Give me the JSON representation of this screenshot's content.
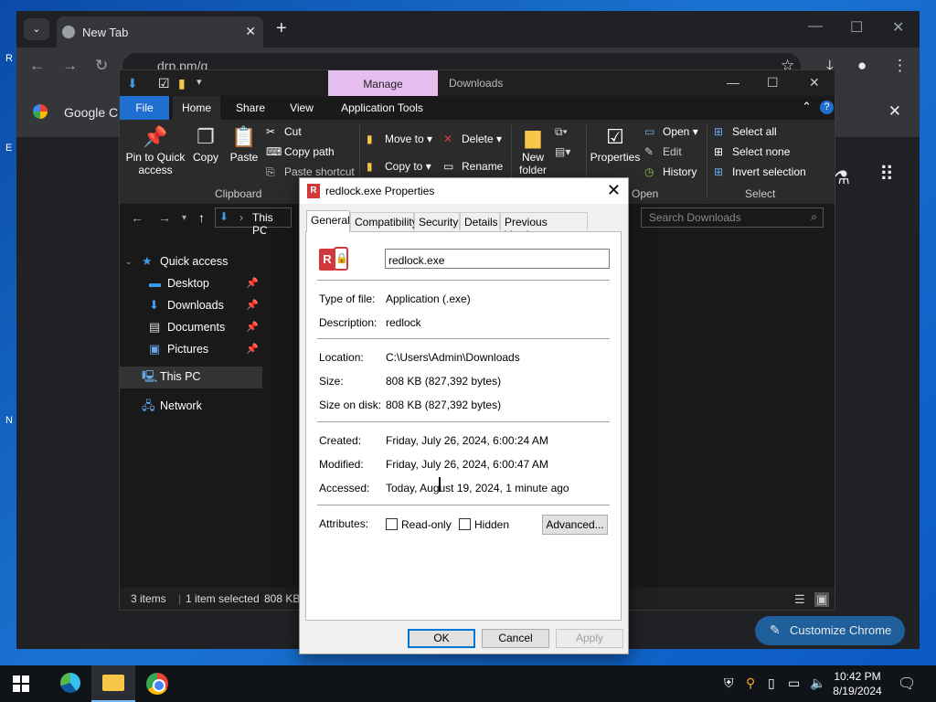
{
  "desktop": {
    "edge_letters": [
      "R",
      "E",
      "N"
    ]
  },
  "chrome": {
    "tab_title": "New Tab",
    "omnibox_text": "drp.pm/g",
    "google_bar_text": "Google Ch",
    "customize_label": "Customize Chrome"
  },
  "explorer": {
    "manage_label": "Manage",
    "window_title": "Downloads",
    "ribbon_tabs": [
      "File",
      "Home",
      "Share",
      "View",
      "Application Tools"
    ],
    "ribbon": {
      "pin_label": "Pin to Quick access",
      "copy_label": "Copy",
      "paste_label": "Paste",
      "cut_label": "Cut",
      "copy_path_label": "Copy path",
      "paste_shortcut_label": "Paste shortcut",
      "clipboard_group": "Clipboard",
      "move_to_label": "Move to",
      "copy_to_label": "Copy to",
      "delete_label": "Delete",
      "rename_label": "Rename",
      "new_folder_label": "New folder",
      "properties_label": "Properties",
      "open_label": "Open",
      "edit_label": "Edit",
      "history_label": "History",
      "open_group": "Open",
      "select_all_label": "Select all",
      "select_none_label": "Select none",
      "invert_selection_label": "Invert selection",
      "select_group": "Select"
    },
    "address_text": "This PC",
    "search_placeholder": "Search Downloads",
    "nav": {
      "quick_access": "Quick access",
      "desktop": "Desktop",
      "downloads": "Downloads",
      "documents": "Documents",
      "pictures": "Pictures",
      "this_pc": "This PC",
      "network": "Network"
    },
    "status": {
      "items": "3 items",
      "selected": "1 item selected",
      "size": "808 KB"
    }
  },
  "dialog": {
    "title": "redlock.exe Properties",
    "tabs": [
      "General",
      "Compatibility",
      "Security",
      "Details",
      "Previous Versions"
    ],
    "file_name": "redlock.exe",
    "type_label": "Type of file:",
    "type_value": "Application (.exe)",
    "description_label": "Description:",
    "description_value": "redlock",
    "location_label": "Location:",
    "location_value": "C:\\Users\\Admin\\Downloads",
    "size_label": "Size:",
    "size_value": "808 KB (827,392 bytes)",
    "size_on_disk_label": "Size on disk:",
    "size_on_disk_value": "808 KB (827,392 bytes)",
    "created_label": "Created:",
    "created_value": "Friday, July 26, 2024, 6:00:24 AM",
    "modified_label": "Modified:",
    "modified_value": "Friday, July 26, 2024, 6:00:47 AM",
    "accessed_label": "Accessed:",
    "accessed_value": "Today, August 19, 2024, 1 minute ago",
    "attributes_label": "Attributes:",
    "readonly_label": "Read-only",
    "hidden_label": "Hidden",
    "advanced_label": "Advanced...",
    "ok_label": "OK",
    "cancel_label": "Cancel",
    "apply_label": "Apply"
  },
  "taskbar": {
    "time": "10:42 PM",
    "date": "8/19/2024"
  },
  "colors": {
    "accent": "#0078d7",
    "explorer_bg": "#191919",
    "manage_tab": "#e6bff0",
    "file_tab": "#1e6fd0"
  }
}
